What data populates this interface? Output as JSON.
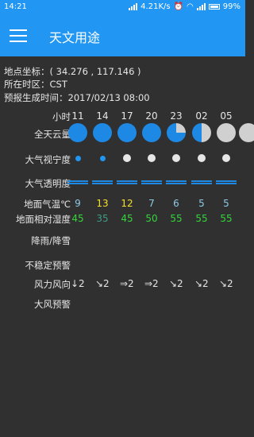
{
  "status": {
    "time": "14:21",
    "speed": "4.21K/s",
    "battery": "99%"
  },
  "appbar": {
    "title": "天文用途"
  },
  "info": {
    "coords_label": "地点坐标：( 34.276 , 117.146 )",
    "timezone_label": "所在时区：CST",
    "generated_label": "预报生成时间：2017/02/13 08:00"
  },
  "labels": {
    "hour": "小时",
    "cloud": "全天云量",
    "seeing": "大气视宁度",
    "transparency": "大气透明度",
    "temp": "地面气温℃",
    "humidity": "地面相对湿度",
    "precip": "降雨/降雪",
    "instability": "不稳定预警",
    "wind": "风力风向",
    "gale": "大风预警"
  },
  "hours": [
    "11",
    "14",
    "17",
    "20",
    "23",
    "02",
    "05"
  ],
  "cloud_cover": [
    1.0,
    1.0,
    1.0,
    1.0,
    0.75,
    0.5,
    0.0
  ],
  "seeing_colors": [
    "#2196f3",
    "#2196f3",
    "#e6e6e6",
    "#e6e6e6",
    "#e6e6e6",
    "#e6e6e6",
    "#e6e6e6"
  ],
  "temperature": [
    "9",
    "13",
    "12",
    "7",
    "6",
    "5",
    "5"
  ],
  "temperature_colors": [
    "#8ecbe6",
    "#f5e12a",
    "#f5e12a",
    "#8ecbe6",
    "#8ecbe6",
    "#8ecbe6",
    "#8ecbe6"
  ],
  "humidity": [
    "45",
    "35",
    "45",
    "50",
    "55",
    "55",
    "55"
  ],
  "humidity_colors": [
    "#34d43b",
    "#3f9a86",
    "#34d43b",
    "#34d43b",
    "#34d43b",
    "#34d43b",
    "#34d43b"
  ],
  "wind": [
    "↓2",
    "↘2",
    "⇒2",
    "⇒2",
    "↘2",
    "↘2",
    "↘2"
  ]
}
